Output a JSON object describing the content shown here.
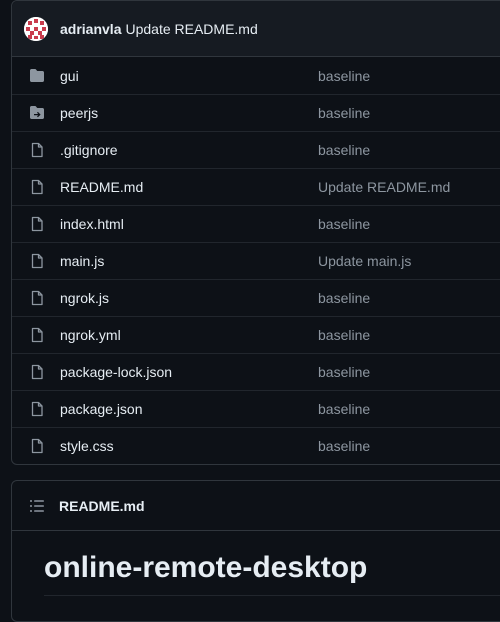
{
  "commit": {
    "author": "adrianvla",
    "message": "Update README.md"
  },
  "files": [
    {
      "name": "gui",
      "type": "folder",
      "icon": "folder-icon",
      "commit_message": "baseline"
    },
    {
      "name": "peerjs",
      "type": "submodule",
      "icon": "folder-submodule-icon",
      "commit_message": "baseline"
    },
    {
      "name": ".gitignore",
      "type": "file",
      "icon": "file-icon",
      "commit_message": "baseline"
    },
    {
      "name": "README.md",
      "type": "file",
      "icon": "file-icon",
      "commit_message": "Update README.md"
    },
    {
      "name": "index.html",
      "type": "file",
      "icon": "file-icon",
      "commit_message": "baseline"
    },
    {
      "name": "main.js",
      "type": "file",
      "icon": "file-icon",
      "commit_message": "Update main.js"
    },
    {
      "name": "ngrok.js",
      "type": "file",
      "icon": "file-icon",
      "commit_message": "baseline"
    },
    {
      "name": "ngrok.yml",
      "type": "file",
      "icon": "file-icon",
      "commit_message": "baseline"
    },
    {
      "name": "package-lock.json",
      "type": "file",
      "icon": "file-icon",
      "commit_message": "baseline"
    },
    {
      "name": "package.json",
      "type": "file",
      "icon": "file-icon",
      "commit_message": "baseline"
    },
    {
      "name": "style.css",
      "type": "file",
      "icon": "file-icon",
      "commit_message": "baseline"
    }
  ],
  "readme": {
    "filename": "README.md",
    "heading": "online-remote-desktop"
  },
  "colors": {
    "background": "#0d1117",
    "header_bg": "#161b22",
    "border": "#30363d",
    "text": "#e6edf3",
    "muted": "#8d96a0",
    "icon": "#8d96a0",
    "avatar_accent": "#c93c4d"
  }
}
